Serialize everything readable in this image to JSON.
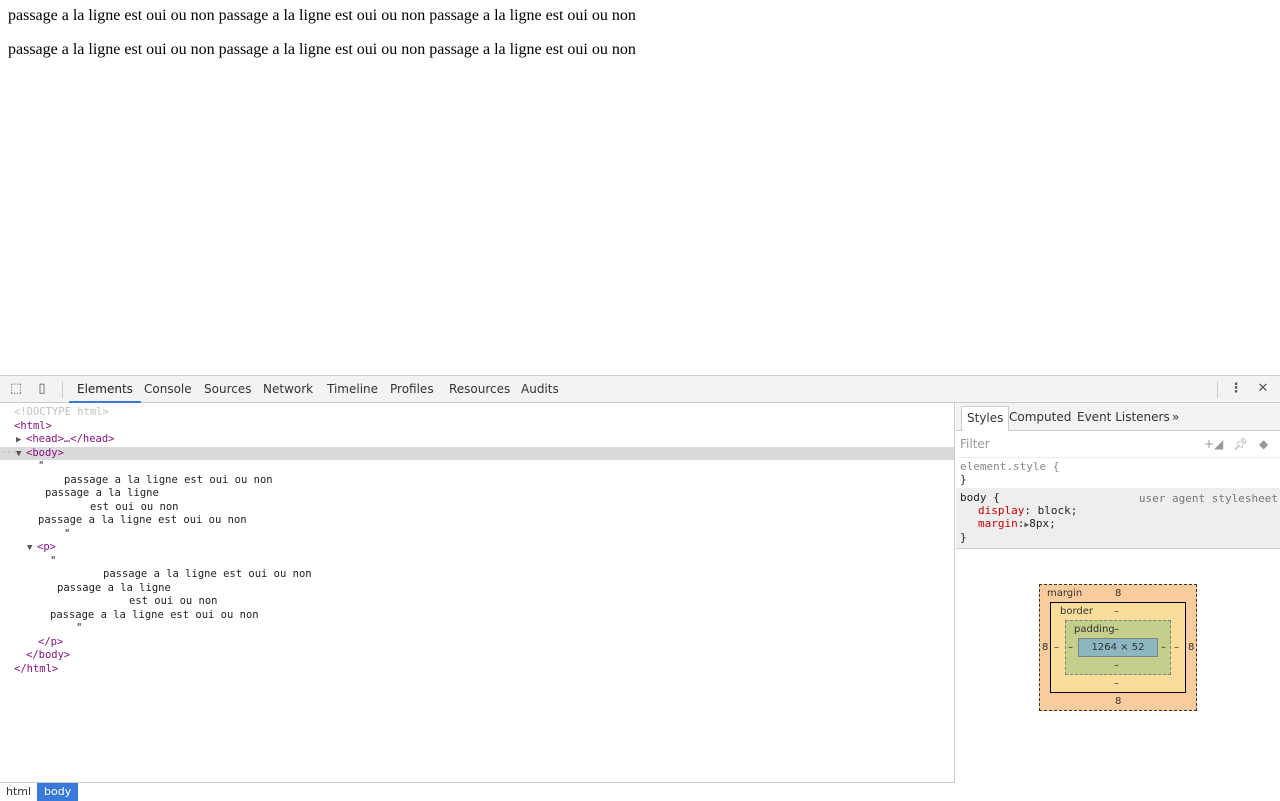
{
  "page": {
    "lines": [
      "passage a la ligne est oui ou non passage a la ligne est oui ou non passage a la ligne est oui ou non",
      "passage a la ligne est oui ou non passage a la ligne est oui ou non passage a la ligne est oui ou non"
    ]
  },
  "devtools": {
    "tabs": [
      "Elements",
      "Console",
      "Sources",
      "Network",
      "Timeline",
      "Profiles",
      "Resources",
      "Audits"
    ],
    "active_tab": "Elements",
    "tree": {
      "doctype": "<!DOCTYPE html>",
      "html_open": "<html>",
      "head": "<head>…</head>",
      "body_open": "<body>",
      "quote": "\"",
      "body_text": [
        "passage a la ligne est oui ou non",
        "passage a la ligne",
        "est oui ou non",
        "passage a la ligne est oui ou non"
      ],
      "p_open": "<p>",
      "p_text": [
        "passage a la ligne est oui ou non",
        "passage a la ligne",
        "est oui ou non",
        "passage a la ligne est oui ou non"
      ],
      "p_close": "</p>",
      "body_close": "</body>",
      "html_close": "</html>"
    },
    "breadcrumbs": [
      "html",
      "body"
    ],
    "sidebar": {
      "tabs": [
        "Styles",
        "Computed",
        "Event Listeners"
      ],
      "more": "»",
      "filter_placeholder": "Filter",
      "element_style": "element.style {",
      "close_brace": "}",
      "body_selector": "body {",
      "source": "user agent stylesheet",
      "props": [
        {
          "name": "display",
          "value": "block;"
        },
        {
          "name": "margin",
          "value": "8px;"
        }
      ],
      "boxmodel": {
        "margin_label": "margin",
        "border_label": "border",
        "padding_label": "padding",
        "margin": "8",
        "dash": "–",
        "content": "1264 × 52"
      }
    }
  }
}
